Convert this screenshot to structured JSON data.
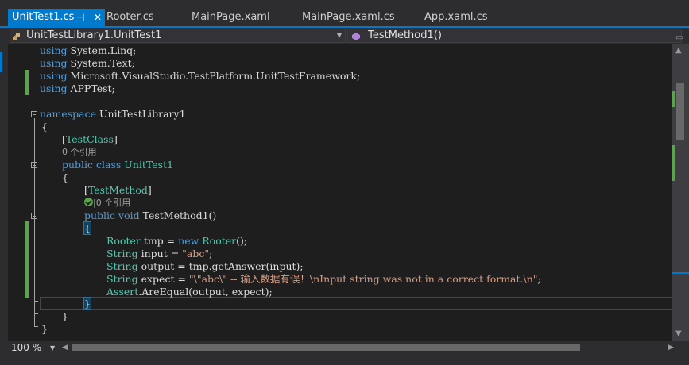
{
  "tabs": [
    {
      "label": "UnitTest1.cs",
      "active": true,
      "pin_icon": "pin-icon",
      "close_icon": "close-icon"
    },
    {
      "label": "Rooter.cs",
      "active": false
    },
    {
      "label": "MainPage.xaml",
      "active": false
    },
    {
      "label": "MainPage.xaml.cs",
      "active": false
    },
    {
      "label": "App.xaml.cs",
      "active": false
    }
  ],
  "navigation": {
    "class_dropdown": "UnitTestLibrary1.UnitTest1",
    "member_dropdown": "TestMethod1()"
  },
  "code": {
    "l1_kw": "using",
    "l1_rest": " System.Linq;",
    "l2_kw": "using",
    "l2_rest": " System.Text;",
    "l3_kw": "using",
    "l3_rest": " Microsoft.VisualStudio.TestPlatform.UnitTestFramework;",
    "l4_kw": "using",
    "l4_rest": " APPTest;",
    "l6_kw": "namespace",
    "l6_rest": " UnitTestLibrary1",
    "l7": "{",
    "l8_open": "[",
    "l8_attr": "TestClass",
    "l8_close": "]",
    "l9_refs": "0 个引用",
    "l10_kw1": "public",
    "l10_kw2": " class",
    "l10_name": " UnitTest1",
    "l11": "{",
    "l12_open": "[",
    "l12_attr": "TestMethod",
    "l12_close": "]",
    "l13_refs": "|0 个引用",
    "l14_kw1": "public",
    "l14_kw2": " void",
    "l14_rest": " TestMethod1()",
    "l15": "{",
    "l16_type": "Rooter",
    "l16_mid": " tmp = ",
    "l16_new": "new",
    "l16_type2": " Rooter",
    "l16_end": "();",
    "l17_type": "String",
    "l17_mid": " input = ",
    "l17_str": "\"abc\"",
    "l17_end": ";",
    "l18_type": "String",
    "l18_rest": " output = tmp.getAnswer(input);",
    "l19_type": "String",
    "l19_mid": " expect = ",
    "l19_str": "\"\\\"abc\\\" -- 输入数据有误！\\nInput string was not in a correct format.\\n\"",
    "l19_end": ";",
    "l20_type": "Assert",
    "l20_rest": ".AreEqual(output, expect);",
    "l21": "}",
    "l22": "}",
    "l23": "}"
  },
  "status": {
    "zoom": "100 %"
  },
  "colors": {
    "accent": "#007acc",
    "keyword": "#569cd6",
    "type": "#4ec9b0",
    "string": "#d69d85",
    "change_marker": "#57a64a"
  },
  "icons": {
    "test_passed": "check-circle-icon",
    "dropdown": "chevron-down-icon",
    "class_icon": "class-icon",
    "method_icon": "method-icon"
  }
}
